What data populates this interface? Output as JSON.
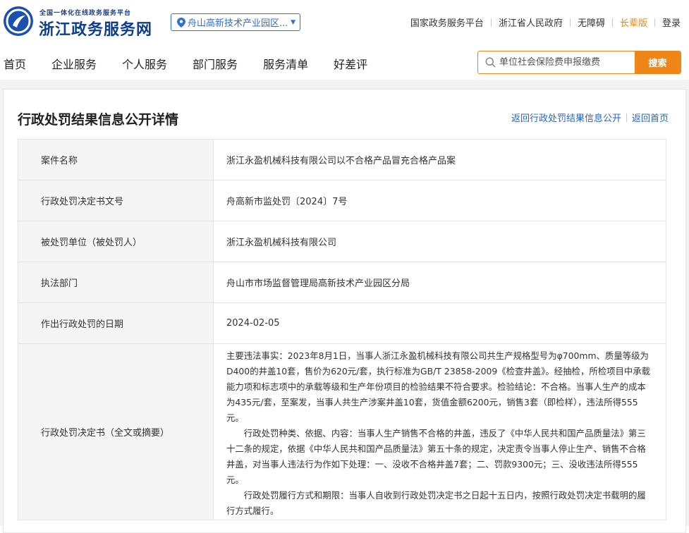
{
  "brand": {
    "small_text": "全国一体化在线政务服务平台",
    "name": "浙江政务服务网"
  },
  "region_selector": {
    "label": "舟山高新技术产业园区..."
  },
  "top_links": [
    {
      "label": "国家政务服务平台"
    },
    {
      "label": "浙江省人民政府"
    },
    {
      "label": "无障碍"
    },
    {
      "label": "长辈版"
    },
    {
      "label": "登录"
    }
  ],
  "nav": {
    "items": [
      {
        "label": "首页"
      },
      {
        "label": "企业服务"
      },
      {
        "label": "个人服务"
      },
      {
        "label": "部门服务"
      },
      {
        "label": "服务清单"
      },
      {
        "label": "好差评"
      }
    ]
  },
  "search": {
    "placeholder": "单位社会保险费申报缴费",
    "button_label": "搜索"
  },
  "colors": {
    "accent_orange": "#f08519",
    "link_blue": "#2a64c8",
    "brand_blue": "#0e3e8c"
  },
  "page": {
    "title": "行政处罚结果信息公开详情",
    "back_list": "返回行政处罚结果信息公开",
    "back_home": "返回首页"
  },
  "details": [
    {
      "key": "案件名称",
      "value": "浙江永盈机械科技有限公司以不合格产品冒充合格产品案"
    },
    {
      "key": "行政处罚决定书文号",
      "value": "舟高新市监处罚〔2024〕7号"
    },
    {
      "key": "被处罚单位（被处罚人）",
      "value": "浙江永盈机械科技有限公司"
    },
    {
      "key": "执法部门",
      "value": "舟山市市场监督管理局高新技术产业园区分局"
    },
    {
      "key": "作出行政处罚的日期",
      "value": "2024-02-05"
    }
  ],
  "decision": {
    "key": "行政处罚决定书（全文或摘要）",
    "paragraphs": [
      "主要违法事实：2023年8月1日，当事人浙江永盈机械科技有限公司共生产规格型号为φ700mm、质量等级为D400的井盖10套，售价为620元/套，执行标准为GB/T 23858-2009《检查井盖》。经抽检，所检项目中承载能力项和标志项中的承载等级和生产年份项目的检验结果不符合要求。检验结论：不合格。当事人生产的成本为435元/套，至案发，当事人共生产涉案井盖10套，货值金额6200元，销售3套（即检样），违法所得555元。",
      "行政处罚种类、依据、内容：当事人生产销售不合格的井盖，违反了《中华人民共和国产品质量法》第三十二条的规定，依据《中华人民共和国产品质量法》第五十条的规定，决定责令当事人停止生产、销售不合格井盖，对当事人违法行为作如下处理：一、没收不合格井盖7套；二、罚款9300元；三、没收违法所得555元。",
      "行政处罚履行方式和期限：当事人自收到行政处罚决定书之日起十五日内，按照行政处罚决定书载明的履行方式履行。"
    ]
  }
}
